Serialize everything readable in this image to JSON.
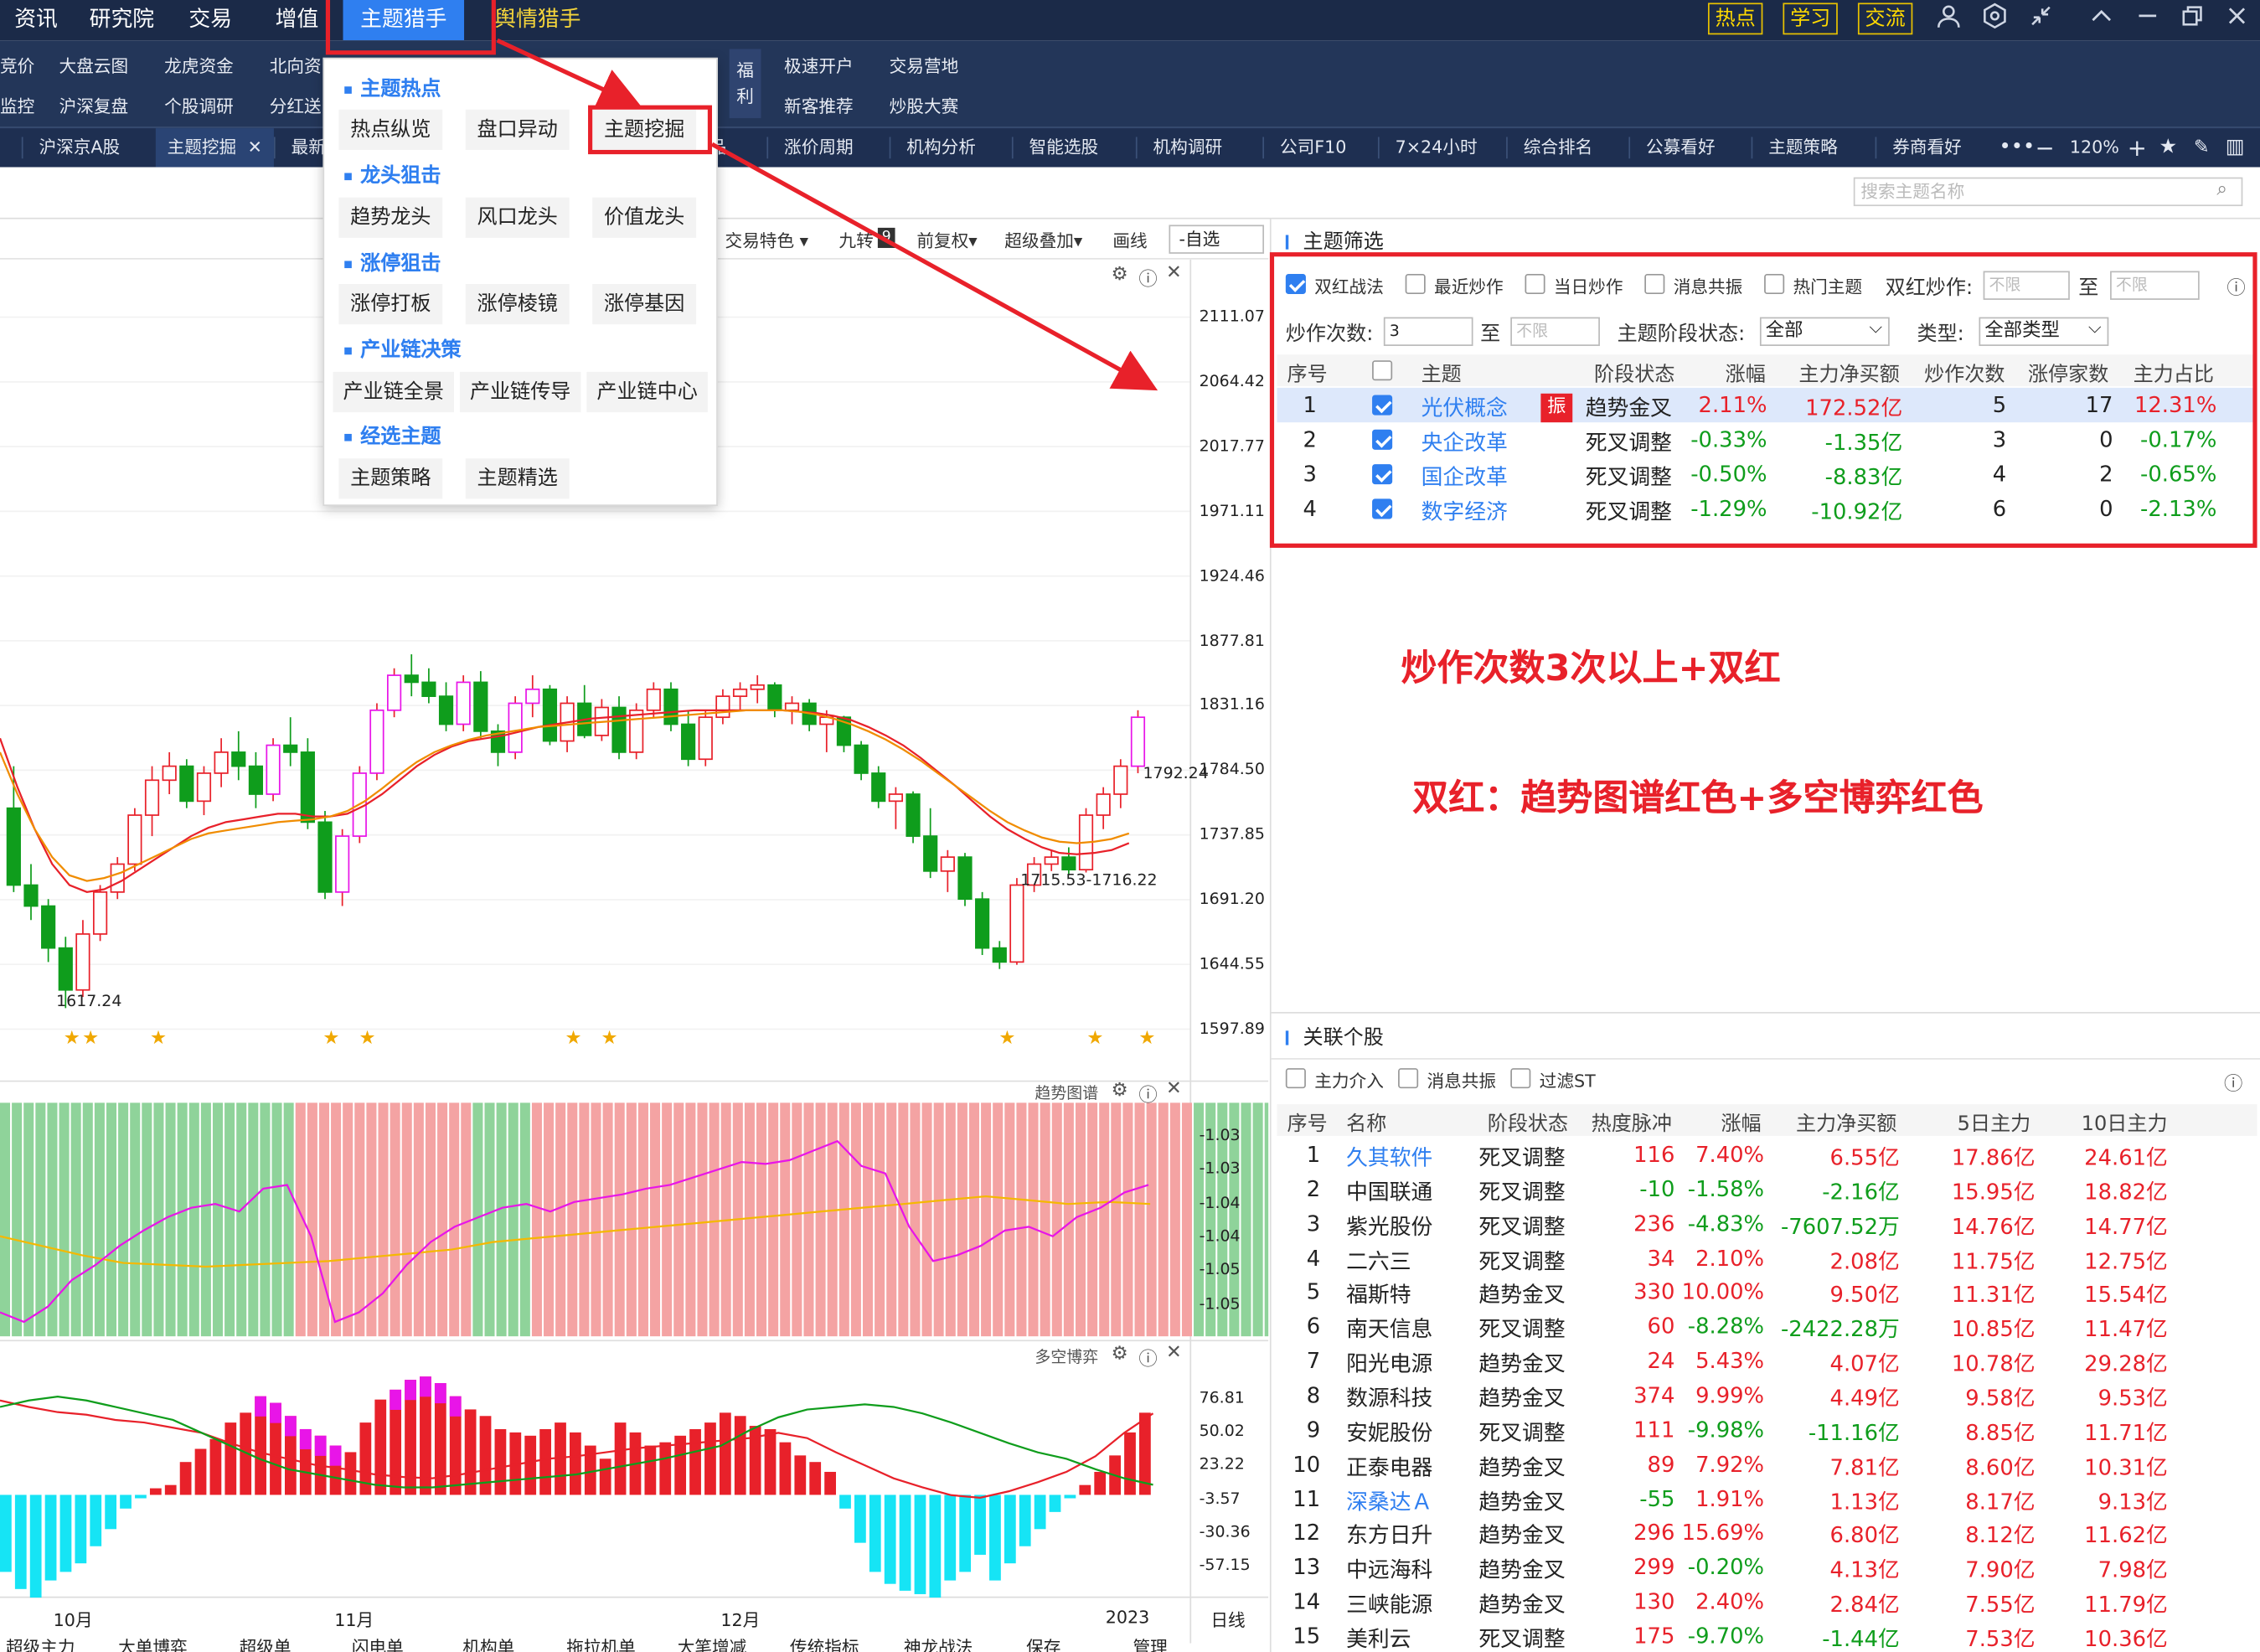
{
  "topnav": [
    {
      "label": "资讯",
      "x": 10
    },
    {
      "label": "研究院",
      "x": 62
    },
    {
      "label": "交易",
      "x": 131
    },
    {
      "label": "增值",
      "x": 191
    }
  ],
  "topnav_active": "主题猎手",
  "topnav_yellow": "舆情猎手",
  "topbuttons": [
    "热点",
    "学习",
    "交流"
  ],
  "menu_row1": [
    {
      "label": "竞价",
      "x": 0
    },
    {
      "label": "大盘云图",
      "x": 41
    },
    {
      "label": "龙虎资金",
      "x": 114
    },
    {
      "label": "北向资",
      "x": 187
    },
    {
      "label": "极速开户",
      "x": 544
    },
    {
      "label": "交易营地",
      "x": 617
    }
  ],
  "menu_row2": [
    {
      "label": "监控",
      "x": 0
    },
    {
      "label": "沪深复盘",
      "x": 41
    },
    {
      "label": "个股调研",
      "x": 114
    },
    {
      "label": "分红送",
      "x": 187
    },
    {
      "label": "新客推荐",
      "x": 544
    },
    {
      "label": "炒股大赛",
      "x": 617
    }
  ],
  "menu_fuli": [
    "福",
    "利"
  ],
  "tabs": [
    {
      "label": "沪深京A股",
      "x": 27
    },
    {
      "label": "最新",
      "x": 202
    },
    {
      "label": "品",
      "x": 492
    },
    {
      "label": "涨价周期",
      "x": 544
    },
    {
      "label": "机构分析",
      "x": 629
    },
    {
      "label": "智能选股",
      "x": 714
    },
    {
      "label": "机构调研",
      "x": 800
    },
    {
      "label": "公司F10",
      "x": 888
    },
    {
      "label": "7×24小时",
      "x": 968
    },
    {
      "label": "综合排名",
      "x": 1057
    },
    {
      "label": "公募看好",
      "x": 1142
    },
    {
      "label": "主题策略",
      "x": 1227
    },
    {
      "label": "券商看好",
      "x": 1313
    }
  ],
  "tab_active": "主题挖掘",
  "zoom": "120%",
  "dropdown": {
    "sections": [
      {
        "title": "主题热点",
        "y": 50,
        "items": [
          {
            "label": "热点纵览",
            "x": 10,
            "y": 75
          },
          {
            "label": "盘口异动",
            "x": 98,
            "y": 75
          },
          {
            "label": "主题挖掘",
            "x": 186,
            "y": 75
          }
        ]
      },
      {
        "title": "龙头狙击",
        "y": 110,
        "items": [
          {
            "label": "趋势龙头",
            "x": 10,
            "y": 136
          },
          {
            "label": "风口龙头",
            "x": 98,
            "y": 136
          },
          {
            "label": "价值龙头",
            "x": 186,
            "y": 136
          }
        ]
      },
      {
        "title": "涨停狙击",
        "y": 171,
        "items": [
          {
            "label": "涨停打板",
            "x": 10,
            "y": 196
          },
          {
            "label": "涨停棱镜",
            "x": 98,
            "y": 196
          },
          {
            "label": "涨停基因",
            "x": 186,
            "y": 196
          }
        ]
      },
      {
        "title": "产业链决策",
        "y": 231,
        "items": [
          {
            "label": "产业链全景",
            "x": 6,
            "y": 257
          },
          {
            "label": "产业链传导",
            "x": 94,
            "y": 257
          },
          {
            "label": "产业链中心",
            "x": 182,
            "y": 257
          }
        ]
      },
      {
        "title": "经选主题",
        "y": 291,
        "items": [
          {
            "label": "主题策略",
            "x": 10,
            "y": 317
          },
          {
            "label": "主题精选",
            "x": 98,
            "y": 317
          }
        ]
      }
    ]
  },
  "search": {
    "placeholder": "搜索主题名称"
  },
  "chart_toolbar": [
    "交易特色 ▾",
    "九转",
    "前复权▾",
    "超级叠加▾",
    "画线",
    "-自选"
  ],
  "chart_toolbar_badge": "9",
  "chart_data": {
    "type": "candlestick",
    "yticks": [
      "2111.07",
      "2064.42",
      "2017.77",
      "1971.11",
      "1924.46",
      "1877.81",
      "1831.16",
      "1784.50",
      "1737.85",
      "1691.20",
      "1644.55",
      "1597.89"
    ],
    "ylim": [
      1597.89,
      2111.07
    ],
    "xticks": [
      "10月",
      "11月",
      "12月",
      "2023"
    ],
    "annotations": [
      "1617.24",
      "1715.53-1716.22",
      "1792.24"
    ],
    "current_price_label": "1792.24",
    "candles": [
      [
        1760,
        1790,
        1700,
        1705
      ],
      [
        1705,
        1720,
        1680,
        1690
      ],
      [
        1690,
        1695,
        1650,
        1660
      ],
      [
        1660,
        1668,
        1617,
        1630
      ],
      [
        1630,
        1680,
        1625,
        1670
      ],
      [
        1670,
        1705,
        1665,
        1700
      ],
      [
        1700,
        1725,
        1695,
        1720
      ],
      [
        1720,
        1760,
        1715,
        1755
      ],
      [
        1755,
        1790,
        1740,
        1780
      ],
      [
        1780,
        1800,
        1770,
        1790
      ],
      [
        1790,
        1795,
        1760,
        1765
      ],
      [
        1765,
        1790,
        1755,
        1785
      ],
      [
        1785,
        1810,
        1775,
        1800
      ],
      [
        1800,
        1815,
        1780,
        1790
      ],
      [
        1790,
        1800,
        1760,
        1770
      ],
      [
        1770,
        1810,
        1765,
        1805
      ],
      [
        1805,
        1825,
        1790,
        1800
      ],
      [
        1800,
        1810,
        1745,
        1750
      ],
      [
        1750,
        1758,
        1695,
        1700
      ],
      [
        1700,
        1745,
        1690,
        1740
      ],
      [
        1740,
        1790,
        1735,
        1785
      ],
      [
        1785,
        1835,
        1780,
        1830
      ],
      [
        1830,
        1860,
        1825,
        1855
      ],
      [
        1855,
        1870,
        1840,
        1850
      ],
      [
        1850,
        1860,
        1835,
        1840
      ],
      [
        1840,
        1850,
        1815,
        1820
      ],
      [
        1820,
        1855,
        1815,
        1850
      ],
      [
        1850,
        1858,
        1810,
        1815
      ],
      [
        1815,
        1820,
        1790,
        1800
      ],
      [
        1800,
        1840,
        1795,
        1835
      ],
      [
        1835,
        1855,
        1825,
        1845
      ],
      [
        1845,
        1848,
        1805,
        1808
      ],
      [
        1808,
        1840,
        1800,
        1835
      ],
      [
        1835,
        1848,
        1810,
        1812
      ],
      [
        1812,
        1838,
        1808,
        1832
      ],
      [
        1832,
        1840,
        1795,
        1800
      ],
      [
        1800,
        1835,
        1795,
        1830
      ],
      [
        1830,
        1850,
        1825,
        1845
      ],
      [
        1845,
        1850,
        1815,
        1820
      ],
      [
        1820,
        1830,
        1790,
        1795
      ],
      [
        1795,
        1830,
        1790,
        1825
      ],
      [
        1825,
        1845,
        1820,
        1840
      ],
      [
        1840,
        1850,
        1830,
        1845
      ],
      [
        1845,
        1855,
        1835,
        1848
      ],
      [
        1848,
        1850,
        1825,
        1830
      ],
      [
        1830,
        1840,
        1820,
        1835
      ],
      [
        1835,
        1838,
        1815,
        1820
      ],
      [
        1820,
        1830,
        1800,
        1825
      ],
      [
        1825,
        1826,
        1800,
        1805
      ],
      [
        1805,
        1808,
        1780,
        1785
      ],
      [
        1785,
        1790,
        1760,
        1765
      ],
      [
        1765,
        1775,
        1745,
        1770
      ],
      [
        1770,
        1772,
        1735,
        1740
      ],
      [
        1740,
        1760,
        1710,
        1715
      ],
      [
        1715,
        1730,
        1700,
        1725
      ],
      [
        1725,
        1728,
        1690,
        1695
      ],
      [
        1695,
        1700,
        1655,
        1660
      ],
      [
        1660,
        1665,
        1645,
        1650
      ],
      [
        1650,
        1710,
        1648,
        1705
      ],
      [
        1705,
        1725,
        1700,
        1720
      ],
      [
        1720,
        1730,
        1715,
        1725
      ],
      [
        1725,
        1732,
        1712,
        1716
      ],
      [
        1716,
        1760,
        1714,
        1755
      ],
      [
        1755,
        1775,
        1745,
        1770
      ],
      [
        1770,
        1795,
        1760,
        1790
      ],
      [
        1790,
        1830,
        1785,
        1825
      ]
    ],
    "ma_red": [
      1810,
      1775,
      1745,
      1720,
      1705,
      1700,
      1702,
      1708,
      1716,
      1724,
      1732,
      1740,
      1746,
      1750,
      1752,
      1754,
      1756,
      1756,
      1754,
      1754,
      1756,
      1762,
      1770,
      1780,
      1790,
      1798,
      1804,
      1808,
      1810,
      1812,
      1815,
      1818,
      1820,
      1822,
      1824,
      1825,
      1826,
      1827,
      1828,
      1829,
      1830,
      1830,
      1830,
      1830,
      1830,
      1830,
      1829,
      1828,
      1826,
      1823,
      1818,
      1812,
      1805,
      1796,
      1786,
      1776,
      1765,
      1754,
      1745,
      1738,
      1732,
      1728,
      1727,
      1728,
      1730,
      1735
    ],
    "ma_orange": [
      1800,
      1770,
      1745,
      1725,
      1712,
      1708,
      1710,
      1714,
      1720,
      1726,
      1732,
      1738,
      1742,
      1744,
      1746,
      1748,
      1750,
      1751,
      1752,
      1754,
      1758,
      1765,
      1774,
      1784,
      1793,
      1800,
      1805,
      1809,
      1812,
      1814,
      1816,
      1818,
      1819,
      1820,
      1821,
      1822,
      1823,
      1824,
      1825,
      1826,
      1827,
      1828,
      1829,
      1830,
      1830,
      1830,
      1829,
      1827,
      1824,
      1820,
      1815,
      1809,
      1802,
      1794,
      1785,
      1776,
      1767,
      1758,
      1750,
      1744,
      1739,
      1736,
      1735,
      1736,
      1738,
      1742
    ],
    "stars": [
      50,
      63,
      110,
      230,
      255,
      398,
      423,
      699,
      760,
      796
    ]
  },
  "trend_panel": {
    "title": "趋势图谱",
    "yticks": [
      "-1.03",
      "-1.03",
      "-1.04",
      "-1.04",
      "-1.05",
      "-1.05"
    ],
    "bars": "GGGGGGGGGGGGGGGGGGGGGGGGGRRRRRRRRRRRRRRRGGGGGRRRRRRRRRRRRRRRRRRRRRRRRRRRRRRRRRRRRRRRRRRRRRRRRRRRRRRRRGGGGGGGGGGRRRR",
    "magenta": [
      0.05,
      0.0,
      0.08,
      0.22,
      0.3,
      0.4,
      0.48,
      0.55,
      0.6,
      0.62,
      0.58,
      0.7,
      0.72,
      0.45,
      0.0,
      0.05,
      0.15,
      0.3,
      0.42,
      0.5,
      0.55,
      0.6,
      0.62,
      0.58,
      0.63,
      0.65,
      0.67,
      0.7,
      0.72,
      0.76,
      0.8,
      0.84,
      0.83,
      0.85,
      0.9,
      0.95,
      0.82,
      0.78,
      0.5,
      0.32,
      0.35,
      0.4,
      0.48,
      0.5,
      0.45,
      0.55,
      0.6,
      0.68,
      0.72
    ],
    "yellow": [
      0.45,
      0.4,
      0.35,
      0.31,
      0.3,
      0.29,
      0.3,
      0.31,
      0.32,
      0.34,
      0.36,
      0.38,
      0.42,
      0.44,
      0.46,
      0.48,
      0.5,
      0.52,
      0.54,
      0.56,
      0.58,
      0.6,
      0.62,
      0.64,
      0.66,
      0.64,
      0.62,
      0.63,
      0.62
    ]
  },
  "duokong_panel": {
    "title": "多空博弈",
    "yticks": [
      "76.81",
      "50.02",
      "23.22",
      "-3.57",
      "-30.36",
      "-57.15"
    ],
    "bars": [
      -45,
      -55,
      -60,
      -50,
      -45,
      -40,
      -30,
      -20,
      -8,
      -2,
      4,
      6,
      20,
      28,
      34,
      44,
      50,
      60,
      56,
      48,
      40,
      36,
      30,
      26,
      44,
      58,
      64,
      70,
      72,
      68,
      60,
      52,
      48,
      40,
      38,
      36,
      40,
      44,
      38,
      30,
      22,
      44,
      38,
      30,
      32,
      36,
      40,
      44,
      50,
      48,
      42,
      40,
      32,
      24,
      20,
      14,
      -8,
      -28,
      -45,
      -52,
      -56,
      -58,
      -60,
      -50,
      -45,
      -35,
      -50,
      -40,
      -30,
      -20,
      -10,
      -2,
      6,
      14,
      24,
      38,
      50
    ],
    "magenta_caps": [
      17,
      18,
      19,
      20,
      21,
      22,
      26,
      27,
      28,
      29,
      30
    ]
  },
  "bottom_tabs": [
    "超级主力",
    "大单博弈",
    "超级单",
    "闪电单",
    "机构单",
    "拖拉机单",
    "大笔增减",
    "传统指标",
    "神龙战法",
    "保存",
    "管理"
  ],
  "axis_right_label": "日线",
  "filter_panel": {
    "title": "主题筛选",
    "checks": [
      {
        "label": "双红战法",
        "checked": true
      },
      {
        "label": "最近炒作",
        "checked": false
      },
      {
        "label": "当日炒作",
        "checked": false
      },
      {
        "label": "消息共振",
        "checked": false
      },
      {
        "label": "热门主题",
        "checked": false
      }
    ],
    "shuanghong_label": "双红炒作:",
    "placeholder_unlimited": "不限",
    "to": "至",
    "count_label": "炒作次数:",
    "count_value": "3",
    "stage_label": "主题阶段状态:",
    "stage_value": "全部",
    "type_label": "类型:",
    "type_value": "全部类型",
    "headers": [
      "序号",
      "主题",
      "阶段状态",
      "涨幅",
      "主力净买额",
      "炒作次数",
      "涨停家数",
      "主力占比"
    ],
    "rows": [
      {
        "no": "1",
        "name": "光伏概念",
        "tag": "振",
        "stage": "趋势金叉",
        "chg": "2.11%",
        "net": "172.52亿",
        "times": "5",
        "limitup": "17",
        "ratio": "12.31%",
        "up": true
      },
      {
        "no": "2",
        "name": "央企改革",
        "tag": "",
        "stage": "死叉调整",
        "chg": "-0.33%",
        "net": "-1.35亿",
        "times": "3",
        "limitup": "0",
        "ratio": "-0.17%",
        "up": false
      },
      {
        "no": "3",
        "name": "国企改革",
        "tag": "",
        "stage": "死叉调整",
        "chg": "-0.50%",
        "net": "-8.83亿",
        "times": "4",
        "limitup": "2",
        "ratio": "-0.65%",
        "up": false
      },
      {
        "no": "4",
        "name": "数字经济",
        "tag": "",
        "stage": "死叉调整",
        "chg": "-1.29%",
        "net": "-10.92亿",
        "times": "6",
        "limitup": "0",
        "ratio": "-2.13%",
        "up": false
      }
    ]
  },
  "annotations": [
    "炒作次数3次以上+双红",
    "双红：趋势图谱红色+多空博弈红色"
  ],
  "stock_panel": {
    "title": "关联个股",
    "checks": [
      "主力介入",
      "消息共振",
      "过滤ST"
    ],
    "headers": [
      "序号",
      "名称",
      "阶段状态",
      "热度脉冲",
      "涨幅",
      "主力净买额",
      "5日主力",
      "10日主力"
    ],
    "rows": [
      [
        "1",
        "久其软件",
        "死叉调整",
        "116",
        "7.40%",
        "6.55亿",
        "17.86亿",
        "24.61亿",
        "blue"
      ],
      [
        "2",
        "中国联通",
        "死叉调整",
        "-10",
        "-1.58%",
        "-2.16亿",
        "15.95亿",
        "18.82亿",
        ""
      ],
      [
        "3",
        "紫光股份",
        "死叉调整",
        "236",
        "-4.83%",
        "-7607.52万",
        "14.76亿",
        "14.77亿",
        ""
      ],
      [
        "4",
        "二六三",
        "死叉调整",
        "34",
        "2.10%",
        "2.08亿",
        "11.75亿",
        "12.75亿",
        ""
      ],
      [
        "5",
        "福斯特",
        "趋势金叉",
        "330",
        "10.00%",
        "9.50亿",
        "11.31亿",
        "15.54亿",
        ""
      ],
      [
        "6",
        "南天信息",
        "死叉调整",
        "60",
        "-8.28%",
        "-2422.28万",
        "10.85亿",
        "11.47亿",
        ""
      ],
      [
        "7",
        "阳光电源",
        "趋势金叉",
        "24",
        "5.43%",
        "4.07亿",
        "10.78亿",
        "29.28亿",
        ""
      ],
      [
        "8",
        "数源科技",
        "趋势金叉",
        "374",
        "9.99%",
        "4.49亿",
        "9.58亿",
        "9.53亿",
        ""
      ],
      [
        "9",
        "安妮股份",
        "死叉调整",
        "111",
        "-9.98%",
        "-11.16亿",
        "8.85亿",
        "11.71亿",
        ""
      ],
      [
        "10",
        "正泰电器",
        "趋势金叉",
        "89",
        "7.92%",
        "7.81亿",
        "8.60亿",
        "10.31亿",
        ""
      ],
      [
        "11",
        "深桑达Ａ",
        "趋势金叉",
        "-55",
        "1.91%",
        "1.13亿",
        "8.17亿",
        "9.13亿",
        "blue"
      ],
      [
        "12",
        "东方日升",
        "趋势金叉",
        "296",
        "15.69%",
        "6.80亿",
        "8.12亿",
        "11.62亿",
        ""
      ],
      [
        "13",
        "中远海科",
        "趋势金叉",
        "299",
        "-0.20%",
        "4.13亿",
        "7.90亿",
        "7.98亿",
        ""
      ],
      [
        "14",
        "三峡能源",
        "趋势金叉",
        "130",
        "2.40%",
        "2.84亿",
        "7.55亿",
        "11.79亿",
        ""
      ],
      [
        "15",
        "美利云",
        "死叉调整",
        "175",
        "-9.70%",
        "-1.44亿",
        "7.53亿",
        "10.36亿",
        ""
      ]
    ]
  },
  "colors": {
    "up": "#e8212a",
    "down": "#0f9d1c",
    "accent": "#2f7ff0",
    "nav": "#1b2a48",
    "trend_red": "#f2a0a0",
    "trend_green": "#8fd49a",
    "cyan": "#00e5ff",
    "magenta": "#e815e8"
  }
}
